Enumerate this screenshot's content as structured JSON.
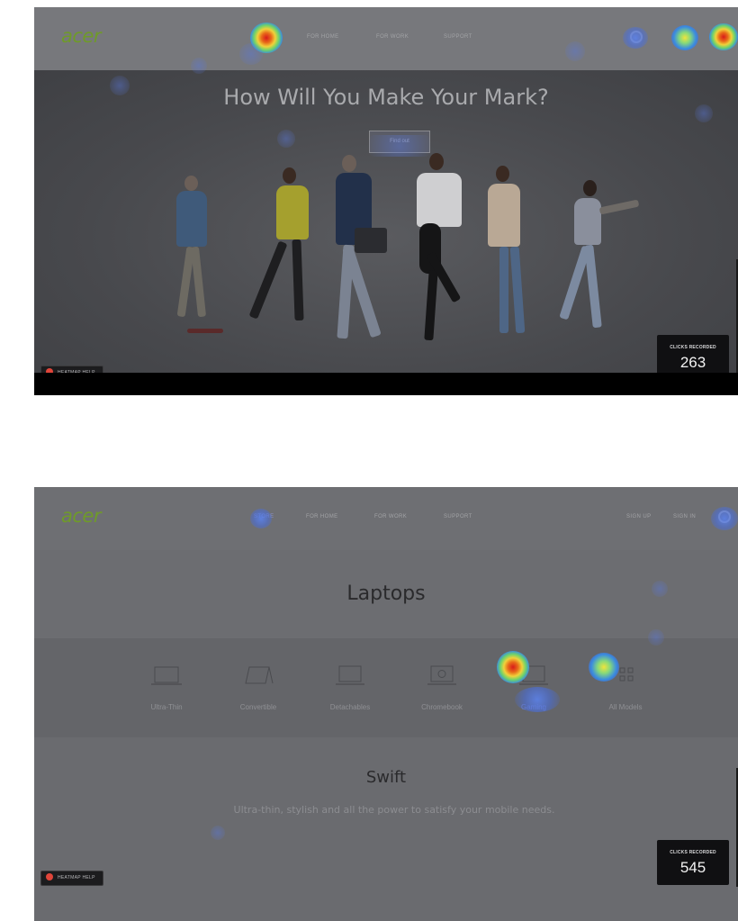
{
  "shot1": {
    "brand": "acer",
    "nav_links": [
      "FOR HOME",
      "FOR WORK",
      "SUPPORT"
    ],
    "hero_title": "How Will You Make Your Mark?",
    "hero_button": "Find out",
    "help_label": "HEATMAP HELP",
    "clicks_label": "CLICKS RECORDED",
    "clicks_value": "263"
  },
  "shot2": {
    "brand": "acer",
    "nav_links": [
      "STORE",
      "FOR HOME",
      "FOR WORK",
      "SUPPORT"
    ],
    "util_links": [
      "SIGN UP",
      "SIGN IN"
    ],
    "section_title": "Laptops",
    "categories": [
      {
        "label": "Ultra-Thin",
        "icon": "laptop-thin-icon"
      },
      {
        "label": "Convertible",
        "icon": "laptop-convertible-icon"
      },
      {
        "label": "Detachables",
        "icon": "laptop-detachable-icon"
      },
      {
        "label": "Chromebook",
        "icon": "chromebook-icon"
      },
      {
        "label": "Gaming",
        "icon": "laptop-gaming-icon"
      },
      {
        "label": "All Models",
        "icon": "grid-icon"
      }
    ],
    "sub_title": "Swift",
    "sub_desc": "Ultra-thin, stylish and all the power to satisfy your mobile needs.",
    "help_label": "HEATMAP HELP",
    "clicks_label": "CLICKS RECORDED",
    "clicks_value": "545"
  },
  "colors": {
    "brand_green": "#6f9a2a",
    "heat_hot": "#d81b1b",
    "heat_cool": "#3a8be0"
  }
}
